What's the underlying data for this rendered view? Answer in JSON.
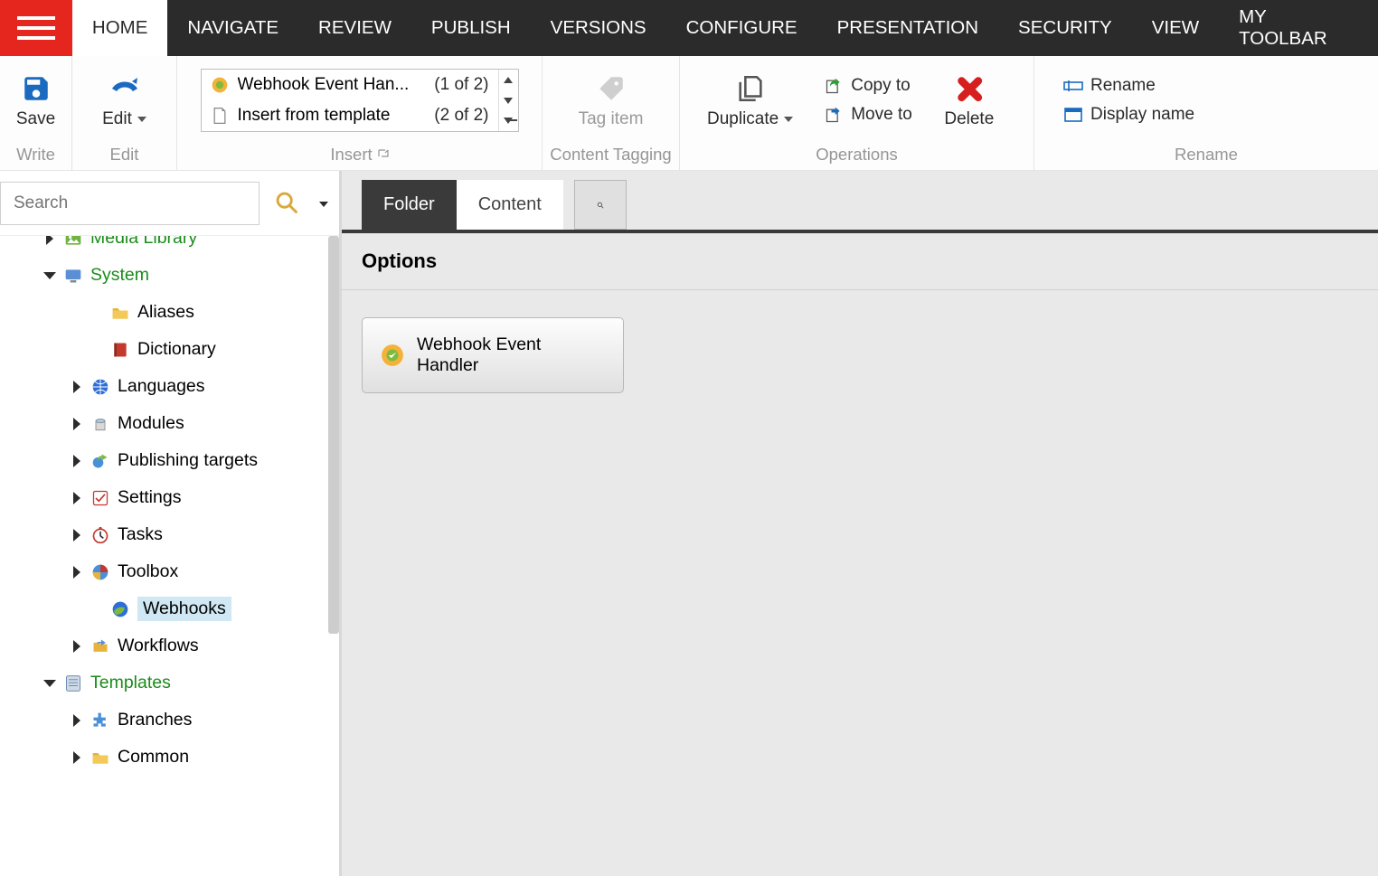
{
  "menu": {
    "tabs": [
      "HOME",
      "NAVIGATE",
      "REVIEW",
      "PUBLISH",
      "VERSIONS",
      "CONFIGURE",
      "PRESENTATION",
      "SECURITY",
      "VIEW",
      "MY TOOLBAR"
    ],
    "active": 0
  },
  "ribbon": {
    "save_label": "Save",
    "write_label": "Write",
    "edit_label": "Edit",
    "edit_group_label": "Edit",
    "insert_group_label": "Insert",
    "insert_items": [
      {
        "label": "Webhook Event Han...",
        "count": "(1 of 2)"
      },
      {
        "label": "Insert from template",
        "count": "(2 of 2)"
      }
    ],
    "content_tagging_group_label": "Content Tagging",
    "tag_item_label": "Tag item",
    "operations_group_label": "Operations",
    "duplicate_label": "Duplicate",
    "copy_to_label": "Copy to",
    "move_to_label": "Move to",
    "delete_label": "Delete",
    "rename_group_label": "Rename",
    "rename_label": "Rename",
    "display_name_label": "Display name"
  },
  "search": {
    "placeholder": "Search"
  },
  "tree": {
    "nodes": [
      {
        "indent": 48,
        "expander": "right",
        "icon": "media-library",
        "label": "Media Library",
        "green": true,
        "cutoff": true
      },
      {
        "indent": 48,
        "expander": "down",
        "icon": "system",
        "label": "System",
        "green": true
      },
      {
        "indent": 100,
        "expander": "none",
        "icon": "folder",
        "label": "Aliases"
      },
      {
        "indent": 100,
        "expander": "none",
        "icon": "dictionary",
        "label": "Dictionary"
      },
      {
        "indent": 78,
        "expander": "right",
        "icon": "languages",
        "label": "Languages"
      },
      {
        "indent": 78,
        "expander": "right",
        "icon": "modules",
        "label": "Modules"
      },
      {
        "indent": 78,
        "expander": "right",
        "icon": "publishing",
        "label": "Publishing targets"
      },
      {
        "indent": 78,
        "expander": "right",
        "icon": "settings",
        "label": "Settings"
      },
      {
        "indent": 78,
        "expander": "right",
        "icon": "tasks",
        "label": "Tasks"
      },
      {
        "indent": 78,
        "expander": "right",
        "icon": "toolbox",
        "label": "Toolbox"
      },
      {
        "indent": 100,
        "expander": "none",
        "icon": "webhooks",
        "label": "Webhooks",
        "selected": true
      },
      {
        "indent": 78,
        "expander": "right",
        "icon": "workflows",
        "label": "Workflows"
      },
      {
        "indent": 48,
        "expander": "down",
        "icon": "templates",
        "label": "Templates",
        "green": true
      },
      {
        "indent": 78,
        "expander": "right",
        "icon": "branches",
        "label": "Branches"
      },
      {
        "indent": 78,
        "expander": "right",
        "icon": "folder",
        "label": "Common"
      }
    ]
  },
  "main": {
    "tabs": {
      "folder": "Folder",
      "content": "Content"
    },
    "section_header": "Options",
    "option_card": "Webhook Event Handler"
  }
}
